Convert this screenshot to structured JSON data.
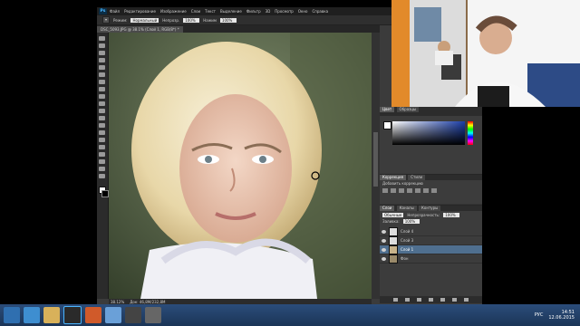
{
  "app": {
    "logo": "Ps",
    "menu": [
      "Файл",
      "Редактирование",
      "Изображение",
      "Слои",
      "Текст",
      "Выделение",
      "Фильтр",
      "3D",
      "Просмотр",
      "Окно",
      "Справка"
    ]
  },
  "options": {
    "mode_label": "Нормальный",
    "opacity_label": "Непрозр.",
    "opacity_value": "100%",
    "flow_label": "Нажим",
    "flow_value": "100%"
  },
  "document": {
    "tab_title": "DSC_5093.JPG @ 38.1% (Слой 1, RGB/8*) *"
  },
  "status": {
    "zoom": "38.12%",
    "doc_size": "Док: 46,8M/232,8M"
  },
  "panels": {
    "color_tabs": [
      "Цвет",
      "Образцы"
    ],
    "adjustments_tabs": [
      "Коррекция",
      "Стили"
    ],
    "adjustments_title": "Добавить коррекцию",
    "layers_tabs": [
      "Слои",
      "Каналы",
      "Контуры"
    ],
    "blend_mode": "Обычные",
    "opacity_label": "Непрозрачность:",
    "opacity_value": "100%",
    "fill_label": "Заливка:",
    "fill_value": "100%",
    "layers": [
      {
        "name": "Слой 4",
        "selected": false
      },
      {
        "name": "Слой 3",
        "selected": false
      },
      {
        "name": "Слой 1",
        "selected": true
      },
      {
        "name": "Фон",
        "selected": false
      }
    ]
  },
  "taskbar": {
    "language": "РУС",
    "time": "14:51",
    "date": "12.06.2015"
  },
  "colors": {
    "accent": "#4f6f8f",
    "ps_blue": "#4ab5ff",
    "taskbar": "#1b3557"
  }
}
